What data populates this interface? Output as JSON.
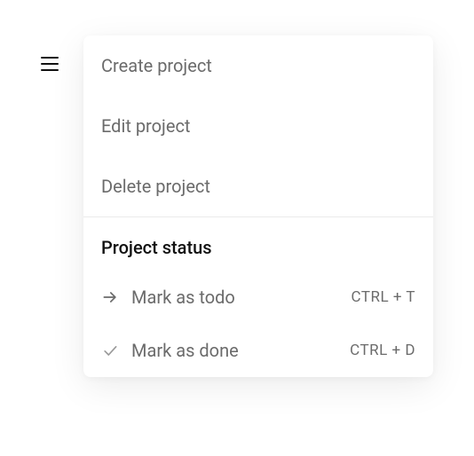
{
  "menu": {
    "items": [
      {
        "label": "Create project"
      },
      {
        "label": "Edit project"
      },
      {
        "label": "Delete project"
      }
    ],
    "section_header": "Project status",
    "submenu": [
      {
        "label": "Mark as todo",
        "shortcut": "CTRL + T"
      },
      {
        "label": "Mark as done",
        "shortcut": "CTRL + D"
      }
    ]
  }
}
